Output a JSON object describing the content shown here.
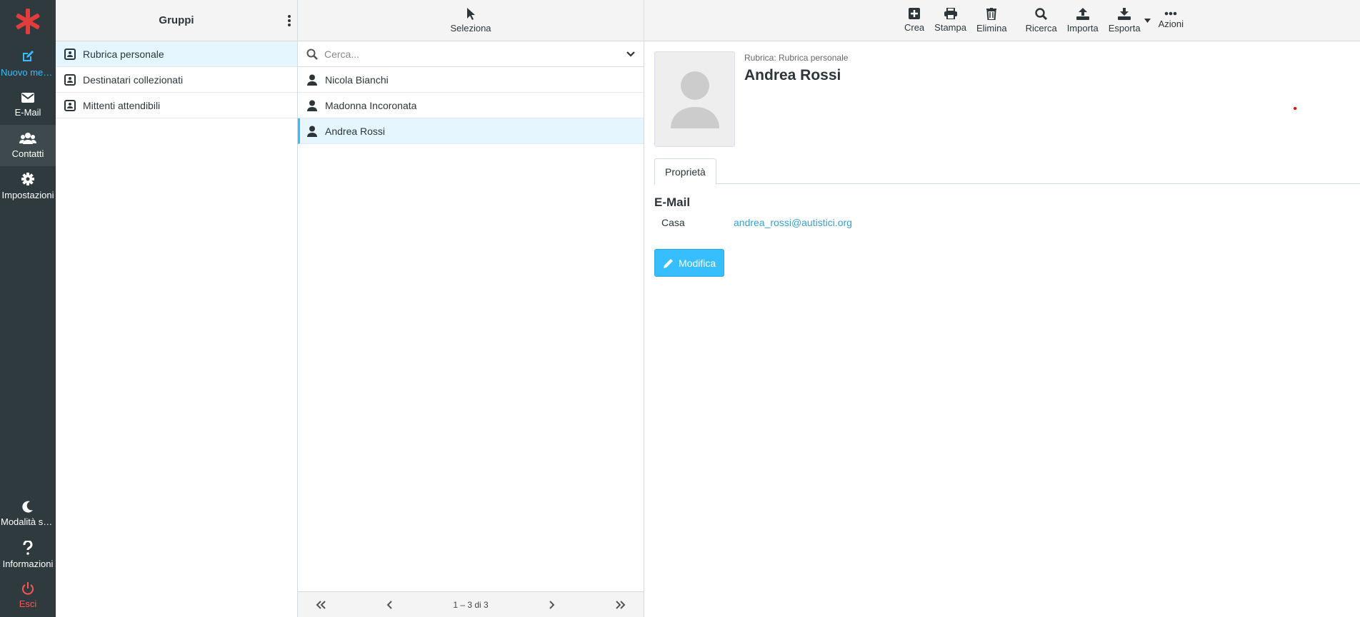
{
  "nav": {
    "items": [
      {
        "label": "Nuovo mes...",
        "icon": "compose-icon"
      },
      {
        "label": "E-Mail",
        "icon": "envelope-icon"
      },
      {
        "label": "Contatti",
        "icon": "users-icon"
      },
      {
        "label": "Impostazioni",
        "icon": "gear-icon"
      },
      {
        "label": "Modalità sc...",
        "icon": "moon-icon"
      },
      {
        "label": "Informazioni",
        "icon": "question-icon"
      },
      {
        "label": "Esci",
        "icon": "power-icon"
      }
    ],
    "active": "Contatti"
  },
  "groups": {
    "title": "Gruppi",
    "items": [
      "Rubrica personale",
      "Destinatari collezionati",
      "Mittenti attendibili"
    ],
    "selected": "Rubrica personale"
  },
  "contacts": {
    "select_label": "Seleziona",
    "search_placeholder": "Cerca...",
    "items": [
      "Nicola Bianchi",
      "Madonna Incoronata",
      "Andrea Rossi"
    ],
    "selected": "Andrea Rossi",
    "pager_text": "1 – 3 di 3"
  },
  "toolbar": {
    "buttons": [
      {
        "label": "Crea",
        "icon": "plus-square-icon"
      },
      {
        "label": "Stampa",
        "icon": "printer-icon"
      },
      {
        "label": "Elimina",
        "icon": "trash-icon"
      },
      {
        "label": "Ricerca",
        "icon": "search-icon"
      },
      {
        "label": "Importa",
        "icon": "upload-icon"
      },
      {
        "label": "Esporta",
        "icon": "download-icon"
      },
      {
        "label": "Azioni",
        "icon": "more-icon"
      }
    ]
  },
  "detail": {
    "addressbook_label": "Rubrica: Rubrica personale",
    "name": "Andrea Rossi",
    "tab": "Proprietà",
    "section": "E-Mail",
    "email_type": "Casa",
    "email": "andrea_rossi@autistici.org",
    "edit_label": "Modifica"
  },
  "colors": {
    "accent": "#37beff",
    "nav_bg": "#2f3a3f",
    "logout": "#ff5552",
    "selected_bg": "#e5f6ff"
  }
}
